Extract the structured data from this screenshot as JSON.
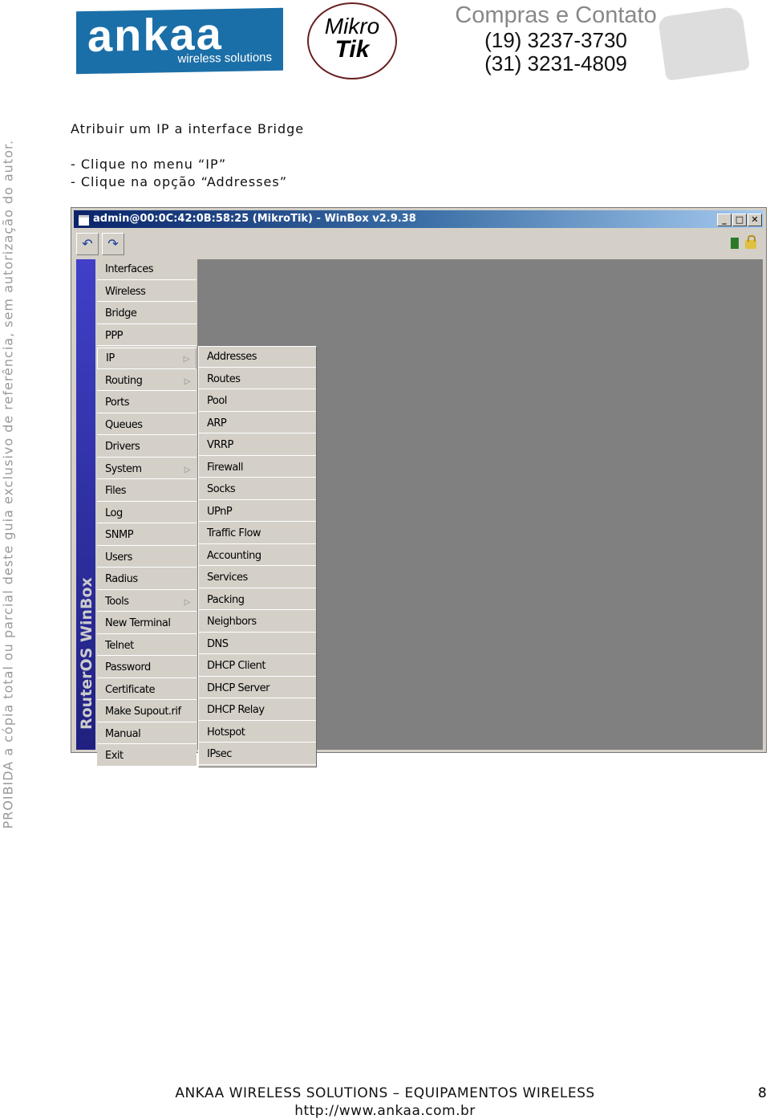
{
  "header": {
    "logo_ankaa": "ankaa",
    "logo_ankaa_sub": "wireless solutions",
    "logo_mikrotik": [
      "Mikro",
      "Tik"
    ],
    "contact_title": "Compras e Contato",
    "phones": [
      "(19) 3237-3730",
      "(31) 3231-4809"
    ]
  },
  "watermark": "PROIBIDA a cópia total ou parcial deste guia exclusivo de referência, sem autorização do autor.",
  "body": {
    "heading": "Atribuir um IP a interface Bridge",
    "steps": [
      "- Clique no menu “IP”",
      "- Clique na opção “Addresses”"
    ]
  },
  "winbox": {
    "title": "admin@00:0C:42:0B:58:25 (MikroTik) - WinBox v2.9.38",
    "side_label": "RouterOS WinBox",
    "menu": [
      "Interfaces",
      "Wireless",
      "Bridge",
      "PPP",
      "IP",
      "Routing",
      "Ports",
      "Queues",
      "Drivers",
      "System",
      "Files",
      "Log",
      "SNMP",
      "Users",
      "Radius",
      "Tools",
      "New Terminal",
      "Telnet",
      "Password",
      "Certificate",
      "Make Supout.rif",
      "Manual",
      "Exit"
    ],
    "submenu_items": [
      "IP",
      "Routing",
      "System",
      "Tools"
    ],
    "selected": "IP",
    "ip_submenu": [
      "Addresses",
      "Routes",
      "Pool",
      "ARP",
      "VRRP",
      "Firewall",
      "Socks",
      "UPnP",
      "Traffic Flow",
      "Accounting",
      "Services",
      "Packing",
      "Neighbors",
      "DNS",
      "DHCP Client",
      "DHCP Server",
      "DHCP Relay",
      "Hotspot",
      "IPsec"
    ],
    "title_gradient": "#0a246a",
    "sidebar_color": "#3030b0"
  },
  "footer": {
    "company": "ANKAA WIRELESS SOLUTIONS – EQUIPAMENTOS WIRELESS",
    "url": "http://www.ankaa.com.br",
    "page": "8"
  }
}
